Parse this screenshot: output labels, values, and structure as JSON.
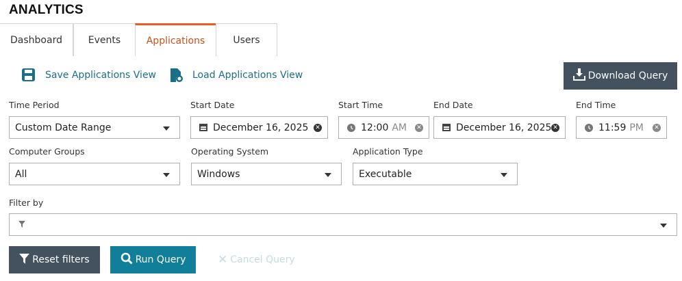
{
  "title": "ANALYTICS",
  "tabs": [
    "Dashboard",
    "Events",
    "Applications",
    "Users"
  ],
  "active_tab": "Applications",
  "actions": {
    "save": "Save Applications View",
    "load": "Load Applications View",
    "download": "Download Query"
  },
  "fields": {
    "time_period": {
      "label": "Time Period",
      "value": "Custom Date Range"
    },
    "start_date": {
      "label": "Start Date",
      "value": "December 16, 2025"
    },
    "start_time": {
      "label": "Start Time",
      "value": "12:00",
      "ampm": "AM"
    },
    "end_date": {
      "label": "End Date",
      "value": "December 16, 2025"
    },
    "end_time": {
      "label": "End Time",
      "value": "11:59",
      "ampm": "PM"
    },
    "computer_groups": {
      "label": "Computer Groups",
      "value": "All"
    },
    "os": {
      "label": "Operating System",
      "value": "Windows"
    },
    "app_type": {
      "label": "Application Type",
      "value": "Executable"
    },
    "filter": {
      "label": "Filter by",
      "value": ""
    }
  },
  "buttons": {
    "reset": "Reset filters",
    "run": "Run Query",
    "cancel": "Cancel Query"
  },
  "colors": {
    "accent": "#f05a22",
    "link": "#1a6e85",
    "dark_button": "#44525f",
    "primary_button": "#117f99"
  }
}
